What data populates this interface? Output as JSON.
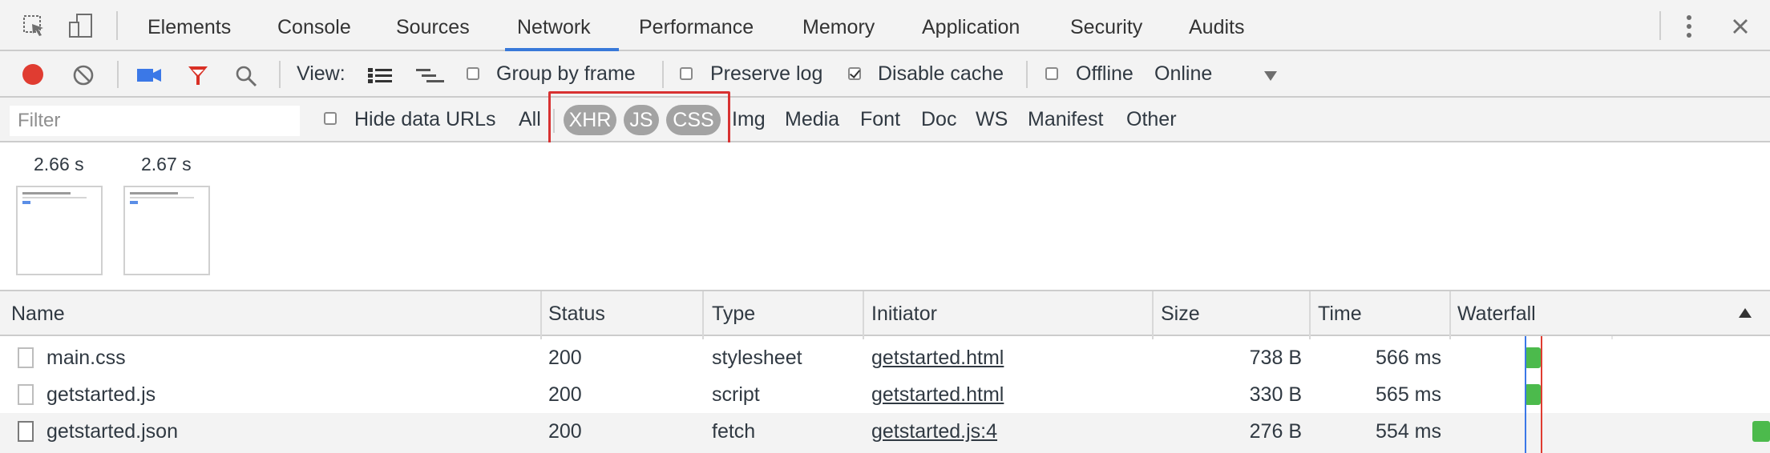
{
  "tabs": [
    {
      "label": "Elements"
    },
    {
      "label": "Console"
    },
    {
      "label": "Sources"
    },
    {
      "label": "Network"
    },
    {
      "label": "Performance"
    },
    {
      "label": "Memory"
    },
    {
      "label": "Application"
    },
    {
      "label": "Security"
    },
    {
      "label": "Audits"
    }
  ],
  "active_tab": "Network",
  "toolbar": {
    "view_label": "View:",
    "group_by_frame": {
      "label": "Group by frame",
      "checked": false
    },
    "preserve_log": {
      "label": "Preserve log",
      "checked": false
    },
    "disable_cache": {
      "label": "Disable cache",
      "checked": true
    },
    "offline": {
      "label": "Offline",
      "checked": false
    },
    "throttle_value": "Online"
  },
  "filterbar": {
    "placeholder": "Filter",
    "value": "",
    "hide_data_urls": {
      "label": "Hide data URLs",
      "checked": false
    },
    "types": [
      "All",
      "XHR",
      "JS",
      "CSS",
      "Img",
      "Media",
      "Font",
      "Doc",
      "WS",
      "Manifest",
      "Other"
    ],
    "selected_types": [
      "XHR",
      "JS",
      "CSS"
    ]
  },
  "filmstrip": [
    {
      "time": "2.66 s"
    },
    {
      "time": "2.67 s"
    }
  ],
  "table": {
    "columns": [
      "Name",
      "Status",
      "Type",
      "Initiator",
      "Size",
      "Time",
      "Waterfall"
    ],
    "rows": [
      {
        "name": "main.css",
        "status": "200",
        "type": "stylesheet",
        "initiator": "getstarted.html",
        "size": "738 B",
        "time": "566 ms"
      },
      {
        "name": "getstarted.js",
        "status": "200",
        "type": "script",
        "initiator": "getstarted.html",
        "size": "330 B",
        "time": "565 ms"
      },
      {
        "name": "getstarted.json",
        "status": "200",
        "type": "fetch",
        "initiator": "getstarted.js:4",
        "size": "276 B",
        "time": "554 ms"
      }
    ]
  },
  "colors": {
    "record": "#e03c31",
    "camera": "#3b78e7",
    "filter_active": "#d93025",
    "tab_underline": "#3879d9",
    "pill_bg": "#a3a3a3",
    "highlight": "#d83232",
    "waterfall_bar": "#4cba4c"
  },
  "icons": [
    "inspect-icon",
    "device-icon",
    "more-icon",
    "close-icon",
    "record-icon",
    "clear-icon",
    "camera-icon",
    "filter-icon",
    "search-icon",
    "large-rows-icon",
    "overview-icon",
    "dropdown-icon",
    "sort-up-icon"
  ]
}
